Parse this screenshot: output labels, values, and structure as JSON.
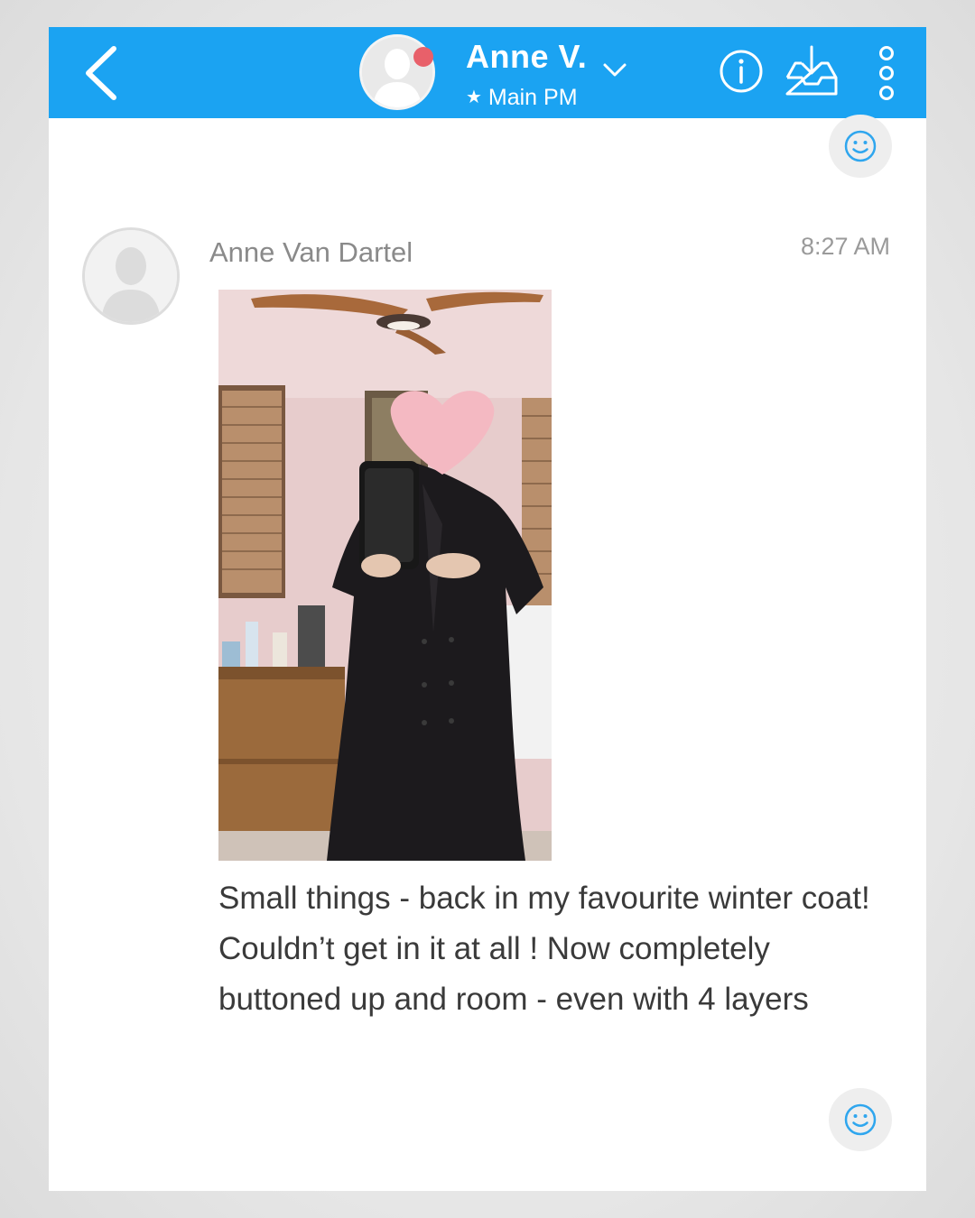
{
  "header": {
    "contact_name": "Anne V.",
    "star": "★",
    "subtitle": "Main PM",
    "background_color": "#1ba3f2",
    "presence_dot_color": "#e8606a",
    "icons": [
      "back-chevron-icon",
      "avatar-placeholder-icon",
      "chevron-down-icon",
      "info-icon",
      "inbox-download-icon",
      "more-vertical-icon"
    ]
  },
  "conversation": {
    "message": {
      "sender": "Anne Van Dartel",
      "time": "8:27 AM",
      "text": "Small things - back in my favourite winter coat! Couldn’t get in it at all ! Now completely buttoned up and room - even with 4 layers",
      "attachment": "photo"
    },
    "reaction_icon": "smiley-icon"
  }
}
